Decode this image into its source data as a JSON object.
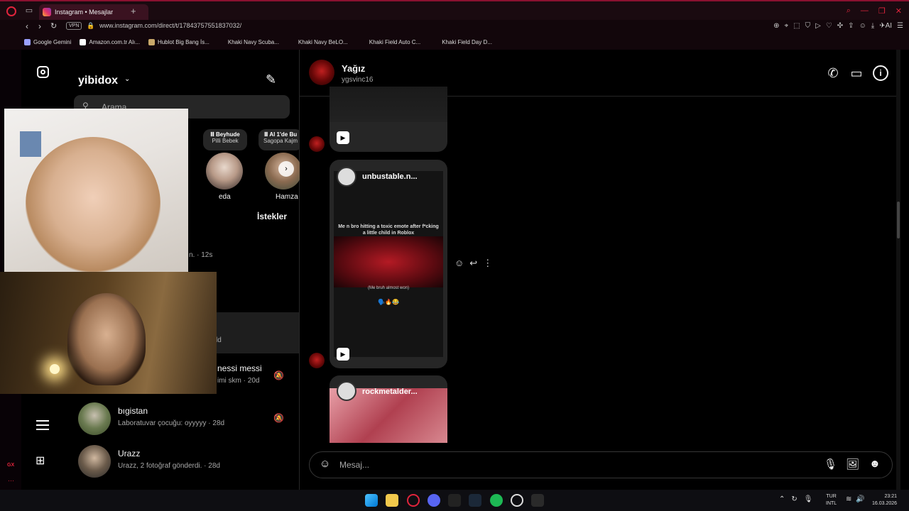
{
  "browser": {
    "tab_title": "Instagram • Mesajlar",
    "new_tab": "+",
    "url": "www.instagram.com/direct/t/17843757551837032/",
    "vpn": "VPN",
    "bookmarks": [
      "Google Gemini",
      "Amazon.com.tr Alı...",
      "Hublot Big Bang İs...",
      "Khaki Navy Scuba...",
      "Khaki Navy BeLO...",
      "Khaki Field Auto C...",
      "Khaki Field Day D..."
    ],
    "sidebar_rail": {
      "gx": "GX",
      "more": "···"
    }
  },
  "sidebar": {
    "account": "yibidox",
    "search_placeholder": "Arama",
    "notes": [
      {
        "title": "Beyhude",
        "subtitle": "Pilli Bebek",
        "name": "eda"
      },
      {
        "title": "Al 1'de Bu",
        "subtitle": "Sagopa Kajm",
        "name": "Hamza"
      }
    ],
    "requests": "İstekler",
    "partial_time": "n. · 12s",
    "partial_row_time": "ld",
    "conversations": [
      {
        "name": "nessi messi",
        "preview": "imi skm · 20d"
      },
      {
        "name": "bıgistan",
        "preview": "Laboratuvar çocuğu: oyyyyy · 28d"
      },
      {
        "name": "Urazz",
        "preview": "Urazz, 2 fotoğraf gönderdi. · 28d"
      }
    ]
  },
  "chat": {
    "name": "Yağız",
    "handle": "ygsvinc16",
    "reel1": {
      "user": "unbustable.n...",
      "caption": "Me n bro hitting a toxic emote after f*cking a little child in Roblox",
      "sub": "(Me bruh almost won)",
      "emoji": "🗣️🔥😂"
    },
    "reel2": {
      "user": "rockmetalder..."
    },
    "composer_placeholder": "Mesaj..."
  },
  "taskbar": {
    "lang_top": "TUR",
    "lang_bottom": "INTL",
    "time": "23:21",
    "date": "16.03.2026"
  },
  "colors": {
    "accent": "#e0243c",
    "ig_bg": "#000000",
    "input_bg": "#262626",
    "secondary_text": "#a8a8a8"
  }
}
